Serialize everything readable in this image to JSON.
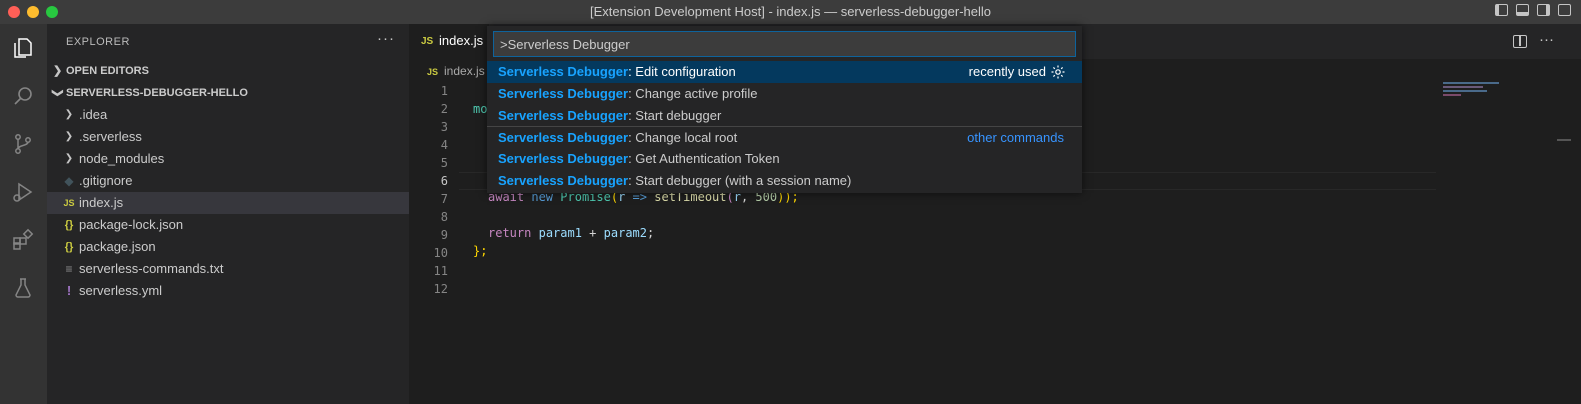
{
  "window": {
    "title": "[Extension Development Host] - index.js — serverless-debugger-hello"
  },
  "activity_bar": {
    "items": [
      "explorer-icon",
      "search-icon",
      "source-control-icon",
      "run-debug-icon",
      "extensions-icon",
      "testing-icon"
    ]
  },
  "sidebar": {
    "title": "EXPLORER",
    "more": "···",
    "sections": {
      "open_editors": "OPEN EDITORS",
      "project": "SERVERLESS-DEBUGGER-HELLO"
    },
    "files": [
      {
        "name": ".idea",
        "type": "folder"
      },
      {
        "name": ".serverless",
        "type": "folder"
      },
      {
        "name": "node_modules",
        "type": "folder"
      },
      {
        "name": ".gitignore",
        "type": "git"
      },
      {
        "name": "index.js",
        "type": "js",
        "selected": true
      },
      {
        "name": "package-lock.json",
        "type": "json"
      },
      {
        "name": "package.json",
        "type": "json"
      },
      {
        "name": "serverless-commands.txt",
        "type": "txt"
      },
      {
        "name": "serverless.yml",
        "type": "yml"
      }
    ]
  },
  "editor": {
    "tab": {
      "icon": "JS",
      "label": "index.js"
    },
    "breadcrumb": {
      "icon": "JS",
      "label": "index.js"
    },
    "more": "···",
    "line_numbers": [
      "1",
      "2",
      "3",
      "4",
      "5",
      "6",
      "7",
      "8",
      "9",
      "10",
      "11",
      "12"
    ],
    "active_line": "6",
    "code": {
      "line2_prefix": "mo",
      "line7": {
        "await": "await",
        "new": "new",
        "promise": "Promise",
        "paren1": "(",
        "r1": "r",
        "arrow": " =>",
        "settimeout": "setTimeout",
        "paren2": "(",
        "r2": "r",
        "comma": ", ",
        "num": "500",
        "close": "));"
      },
      "line9": {
        "ret": "return",
        "p1": "param1",
        "plus": " + ",
        "p2": "param2",
        "semi": ";"
      },
      "line10": "};"
    }
  },
  "command_palette": {
    "input_value": ">Serverless Debugger",
    "items": [
      {
        "prefix": "Serverless Debugger",
        "label": ": Edit configuration",
        "right": "recently used",
        "selected": true
      },
      {
        "prefix": "Serverless Debugger",
        "label": ": Change active profile"
      },
      {
        "prefix": "Serverless Debugger",
        "label": ": Start debugger"
      },
      {
        "prefix": "Serverless Debugger",
        "label": ": Change local root",
        "category": "other commands"
      },
      {
        "prefix": "Serverless Debugger",
        "label": ": Get Authentication Token"
      },
      {
        "prefix": "Serverless Debugger",
        "label": ": Start debugger (with a session name)"
      }
    ]
  },
  "colors": {
    "accent": "#18a3ff",
    "selection": "#04395e",
    "focus_border": "#0e639c"
  }
}
